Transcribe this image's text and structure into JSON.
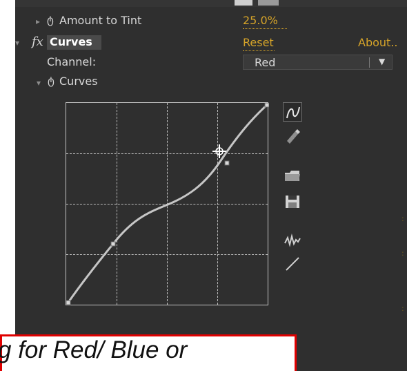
{
  "colors": {
    "panel_bg": "#2f2f2f",
    "text": "#d8d8d8",
    "accent_orange": "#d6a429",
    "caption_border": "#e00000"
  },
  "effect": {
    "amount_to_tint_label": "Amount to Tint",
    "amount_to_tint_value": "25.0%",
    "curves_name": "Curves",
    "reset_label": "Reset",
    "about_label": "About..",
    "channel_label": "Channel:",
    "channel_value": "Red",
    "curves_section_label": "Curves"
  },
  "icons": {
    "collapse_triangle": "▾",
    "expand_triangle": "▸",
    "stopwatch": "ტ",
    "dropdown_arrow": "▼"
  },
  "curve": {
    "control_points": [
      [
        0.0,
        0.0
      ],
      [
        0.25,
        0.25
      ],
      [
        0.5,
        0.5
      ],
      [
        0.75,
        0.75
      ],
      [
        1.0,
        1.0
      ]
    ]
  },
  "tools": [
    "bezier-tool",
    "pencil-tool",
    "open-folder",
    "save",
    "smooth",
    "linear-reset"
  ],
  "caption": {
    "text": "g for Red/ Blue or"
  }
}
